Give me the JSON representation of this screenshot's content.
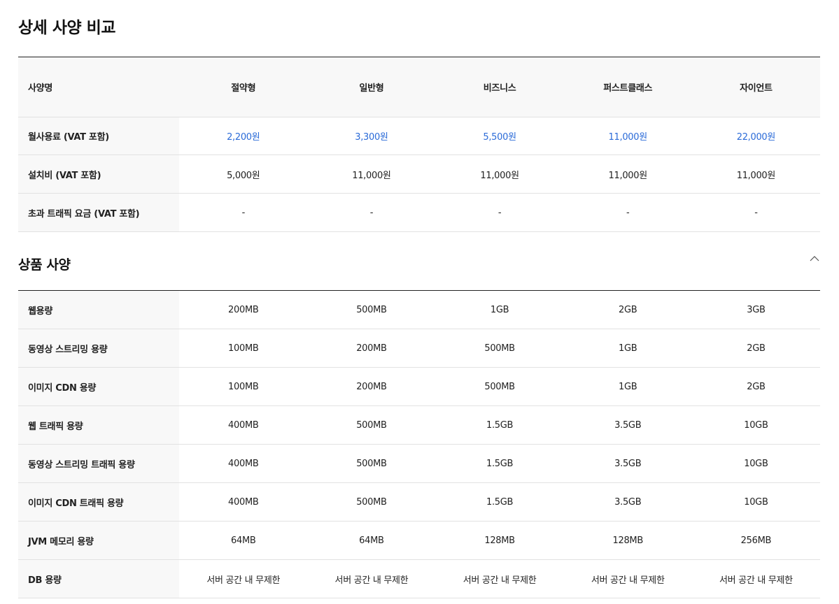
{
  "page_title": "상세 사양 비교",
  "price_table": {
    "header": {
      "label": "사양명",
      "plans": [
        "절약형",
        "일반형",
        "비즈니스",
        "퍼스트클래스",
        "자이언트"
      ]
    },
    "rows": [
      {
        "label": "월사용료 (VAT 포함)",
        "values": [
          "2,200원",
          "3,300원",
          "5,500원",
          "11,000원",
          "22,000원"
        ],
        "highlight": true
      },
      {
        "label": "설치비 (VAT 포함)",
        "values": [
          "5,000원",
          "11,000원",
          "11,000원",
          "11,000원",
          "11,000원"
        ],
        "highlight": false
      },
      {
        "label": "초과 트래픽 요금 (VAT 포함)",
        "values": [
          "-",
          "-",
          "-",
          "-",
          "-"
        ],
        "highlight": false
      }
    ]
  },
  "section": {
    "title": "상품 사양",
    "toggle_icon": "chevron-up-icon"
  },
  "spec_table": {
    "rows": [
      {
        "label": "웹용량",
        "values": [
          "200MB",
          "500MB",
          "1GB",
          "2GB",
          "3GB"
        ]
      },
      {
        "label": "동영상 스트리밍 용량",
        "values": [
          "100MB",
          "200MB",
          "500MB",
          "1GB",
          "2GB"
        ]
      },
      {
        "label": "이미지 CDN 용량",
        "values": [
          "100MB",
          "200MB",
          "500MB",
          "1GB",
          "2GB"
        ]
      },
      {
        "label": "웹 트래픽 용량",
        "values": [
          "400MB",
          "500MB",
          "1.5GB",
          "3.5GB",
          "10GB"
        ]
      },
      {
        "label": "동영상 스트리밍 트래픽 용량",
        "values": [
          "400MB",
          "500MB",
          "1.5GB",
          "3.5GB",
          "10GB"
        ]
      },
      {
        "label": "이미지 CDN 트래픽 용량",
        "values": [
          "400MB",
          "500MB",
          "1.5GB",
          "3.5GB",
          "10GB"
        ]
      },
      {
        "label": "JVM 메모리 용량",
        "values": [
          "64MB",
          "64MB",
          "128MB",
          "128MB",
          "256MB"
        ]
      },
      {
        "label": "DB 용량",
        "values": [
          "서버 공간 내 무제한",
          "서버 공간 내 무제한",
          "서버 공간 내 무제한",
          "서버 공간 내 무제한",
          "서버 공간 내 무제한"
        ]
      }
    ]
  },
  "colors": {
    "price_highlight": "#2b6bd8",
    "label_background": "#f8f8f8",
    "row_divider": "#e2e2e2",
    "table_top_border": "#222222"
  }
}
